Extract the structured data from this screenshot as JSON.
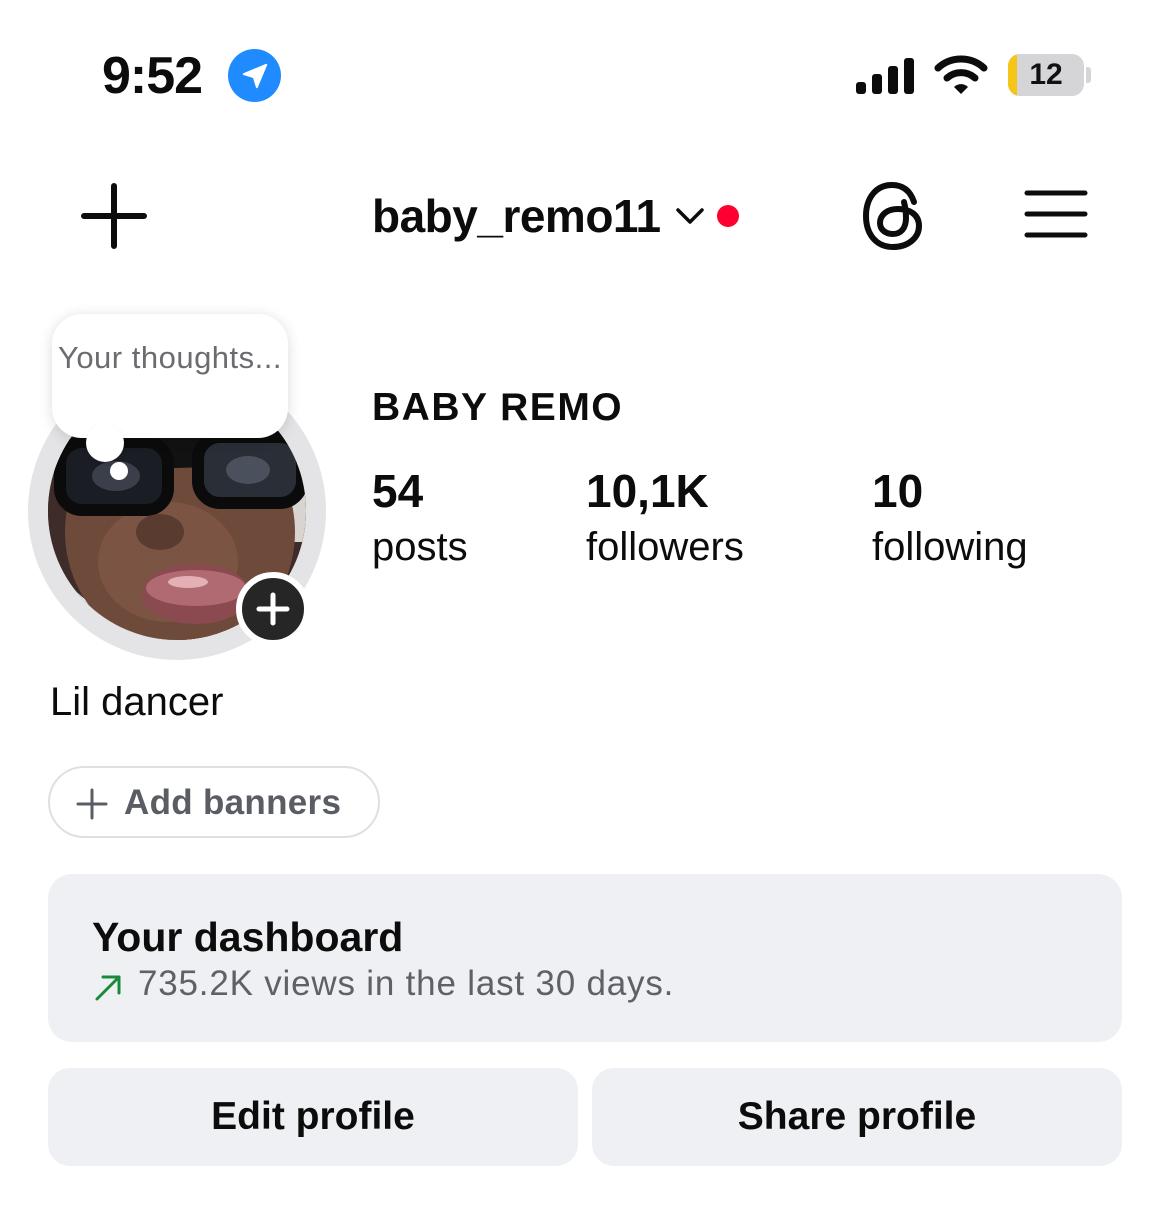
{
  "status_bar": {
    "time": "9:52",
    "battery": {
      "level_text": "12",
      "level_percent": 12,
      "fill_color": "#f5c518"
    },
    "icons": [
      "location-arrow-icon",
      "cellular-signal-icon",
      "wifi-icon",
      "battery-icon"
    ]
  },
  "nav": {
    "username": "baby_remo11",
    "icons": [
      "plus-icon",
      "chevron-down-icon",
      "threads-icon",
      "hamburger-menu-icon"
    ],
    "notification_color": "#ff0033"
  },
  "profile": {
    "note_text": "Your thoughts...",
    "display_name": "BABY REMO",
    "stats": [
      {
        "value": "54",
        "label": "posts"
      },
      {
        "value": "10,1K",
        "label": "followers"
      },
      {
        "value": "10",
        "label": "following"
      }
    ],
    "bio": "Lil dancer"
  },
  "banners": {
    "add_label": "Add banners"
  },
  "dashboard": {
    "title": "Your dashboard",
    "stat_text": "735.2K views in the last 30 days.",
    "trend_color": "#1a8a3a"
  },
  "actions": {
    "edit_label": "Edit profile",
    "share_label": "Share profile"
  }
}
